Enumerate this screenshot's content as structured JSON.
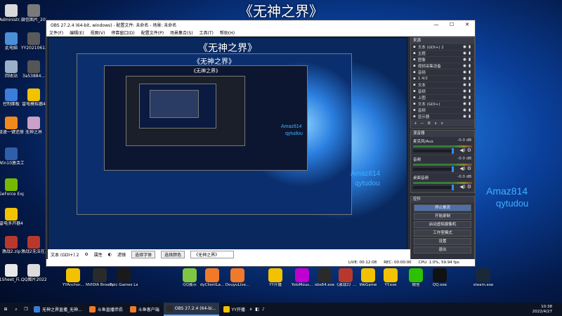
{
  "overlay_title": "《无神之界》",
  "desktop_icons_left": [
    {
      "label": "Administr...",
      "color": "#d9d9d9",
      "icon": "user-folder-icon"
    },
    {
      "label": "此电脑",
      "color": "#4a90d9",
      "icon": "computer-icon"
    },
    {
      "label": "回收站",
      "color": "#9ab0c8",
      "icon": "recycle-bin-icon"
    },
    {
      "label": "控制面板",
      "color": "#3b7dd8",
      "icon": "control-panel-icon"
    },
    {
      "label": "极速一键还原",
      "color": "#f08a1c",
      "icon": "restore-icon"
    },
    {
      "label": "Win10激活工具",
      "color": "#2f5fa8",
      "icon": "activation-icon"
    },
    {
      "label": "GeForce Experience",
      "color": "#76b900",
      "icon": "nvidia-icon"
    },
    {
      "label": "雷电多开器4",
      "color": "#f2c200",
      "icon": "emulator-icon"
    },
    {
      "label": "激战2.zip",
      "color": "#b8392c",
      "icon": "archive-icon"
    },
    {
      "label": "1Sheet_Fi...",
      "color": "#e8e8e8",
      "icon": "file-icon"
    }
  ],
  "desktop_icons_col2": [
    {
      "label": "微信图片_2022045...",
      "color": "#7a7a7a",
      "icon": "image-file-icon"
    },
    {
      "label": "YY2021061...",
      "color": "#5a5a5a",
      "icon": "file-icon"
    },
    {
      "label": "3a5388​4...",
      "color": "#555",
      "icon": "file-icon"
    },
    {
      "label": "雷电模拟器4",
      "color": "#f2c200",
      "icon": "emulator-icon"
    },
    {
      "label": "无神之界",
      "color": "#c9a0c8",
      "icon": "game-icon"
    },
    {
      "label": "激战2无法在...",
      "color": "#b8392c",
      "icon": "game-icon"
    },
    {
      "label": "QQ图片2022048...",
      "color": "#dcdcdc",
      "icon": "image-file-icon"
    }
  ],
  "dock_icons": [
    {
      "label": "YYAnchor...",
      "color": "#f2c200",
      "icon": "yy-anchor-icon"
    },
    {
      "label": "NVIDIA Broadcast",
      "color": "#2a2a2a",
      "icon": "nvidia-broadcast-icon"
    },
    {
      "label": "Epic Games Launcher",
      "color": "#1a1a1a",
      "icon": "epic-games-icon"
    },
    {
      "label": "QQ展示",
      "color": "#7fc642",
      "icon": "qq-show-icon"
    },
    {
      "label": "dyClientLa...",
      "color": "#f07a2a",
      "icon": "douyu-client-icon"
    },
    {
      "label": "DouyuLive...",
      "color": "#f07a2a",
      "icon": "douyu-live-icon"
    },
    {
      "label": "YY开播",
      "color": "#f2c200",
      "icon": "yy-live-icon"
    },
    {
      "label": "YoloMous...",
      "color": "#c000d0",
      "icon": "yolo-mouse-icon"
    },
    {
      "label": "obs64.exe",
      "color": "#2a2a2a",
      "icon": "obs-icon"
    },
    {
      "label": "《激战2》...",
      "color": "#b8392c",
      "icon": "guildwars-icon"
    },
    {
      "label": "WeGame",
      "color": "#f2c200",
      "icon": "wegame-icon"
    },
    {
      "label": "YY.exe",
      "color": "#f2c200",
      "icon": "yy-icon"
    },
    {
      "label": "微信",
      "color": "#2dc100",
      "icon": "wechat-icon"
    },
    {
      "label": "QQ.exe",
      "color": "#111",
      "icon": "qq-icon"
    },
    {
      "label": "steam.exe",
      "color": "#1b2838",
      "icon": "steam-icon"
    }
  ],
  "obs": {
    "window_title": "OBS 27.2.4 (64-bit, windows) - 配置文件: 未命名 - 场景: 未命名",
    "window_controls": [
      "—",
      "☐",
      "✕"
    ],
    "menu": [
      "文件(F)",
      "编辑(E)",
      "视图(V)",
      "停靠窗口(D)",
      "配置文件(P)",
      "场景集合(S)",
      "工具(T)",
      "帮助(H)"
    ],
    "preview_title": "《无神之界》",
    "preview_wm_name": "Amaz814",
    "preview_wm_id": "qytudou",
    "sources_title": "来源",
    "sources": [
      {
        "name": "文本 (GDI+) 2",
        "icon": "text-icon"
      },
      {
        "name": "主题",
        "icon": "image-icon"
      },
      {
        "name": "图像",
        "icon": "image-icon"
      },
      {
        "name": "视频采集设备",
        "icon": "camera-icon"
      },
      {
        "name": "音频",
        "icon": "audio-icon"
      },
      {
        "name": "1.4/2",
        "icon": "text-icon"
      },
      {
        "name": "文本",
        "icon": "text-icon"
      },
      {
        "name": "音频",
        "icon": "audio-icon"
      },
      {
        "name": "上图",
        "icon": "image-icon"
      },
      {
        "name": "文本 (GDI+)",
        "icon": "text-icon"
      },
      {
        "name": "音频",
        "icon": "audio-icon"
      },
      {
        "name": "显示器",
        "icon": "monitor-icon"
      }
    ],
    "source_toolbar": [
      "+",
      "−",
      "⚙",
      "∧",
      "∨"
    ],
    "mixer_title": "混音器",
    "mixer": [
      {
        "name": "麦克风/Aux",
        "db": "-0.0 dB",
        "level": 0.95
      },
      {
        "name": "音频",
        "db": "-0.0 dB",
        "level": 0.95
      },
      {
        "name": "桌面音频",
        "db": "-0.0 dB",
        "level": 0.95
      }
    ],
    "controls_title": "控件",
    "controls": [
      {
        "label": "停止推流",
        "active": true
      },
      {
        "label": "开始录制",
        "active": false
      },
      {
        "label": "启动虚拟摄像机",
        "active": false
      },
      {
        "label": "工作室模式",
        "active": false
      },
      {
        "label": "设置",
        "active": false
      },
      {
        "label": "退出",
        "active": false
      }
    ],
    "bottom_bar": {
      "source_name": "文本 (GDI+) 2",
      "props_label": "属性",
      "filters_label": "滤镜",
      "select_font": "选择字体",
      "select_color": "选择颜色",
      "preview_text": "《无神之界》"
    },
    "status": {
      "live_label": "LIVE:",
      "live_time": "00:12:08",
      "rec_label": "REC:",
      "rec_time": "00:00:00",
      "cpu": "CPU: 1.0%, 59.94 fps"
    }
  },
  "outer_watermark": {
    "name": "Amaz814",
    "id": "qytudou"
  },
  "taskbar": {
    "items": [
      {
        "label": "无神之界直播_无神...",
        "active": false,
        "color": "#3b7dd8",
        "icon": "browser-icon"
      },
      {
        "label": "斗鱼直播伴侣",
        "active": false,
        "color": "#f07a2a",
        "icon": "douyu-icon"
      },
      {
        "label": "斗鱼客户端",
        "active": false,
        "color": "#f07a2a",
        "icon": "douyu-icon"
      },
      {
        "label": "OBS 27.2.4 (64-bi...",
        "active": true,
        "color": "#2a2a2a",
        "icon": "obs-icon"
      },
      {
        "label": "YY开播",
        "active": false,
        "color": "#f2c200",
        "icon": "yy-icon"
      }
    ],
    "time": "10:38",
    "date": "2022/4/27"
  }
}
